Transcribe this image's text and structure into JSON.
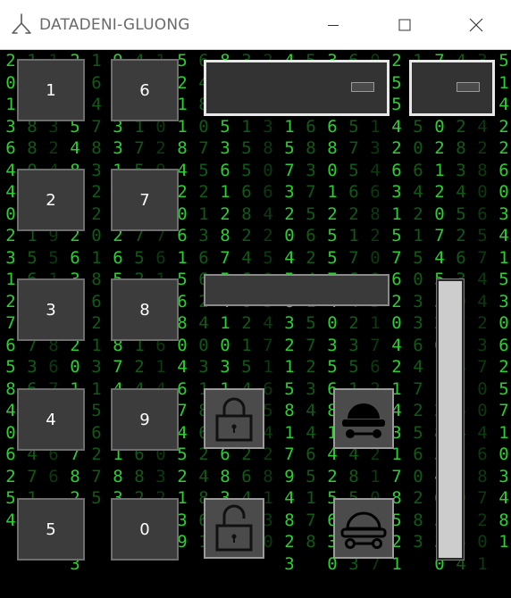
{
  "window": {
    "title": "DATADENI-GLUONG",
    "controls": [
      "minimize",
      "maximize",
      "close"
    ]
  },
  "keypad": {
    "left_column": [
      "1",
      "2",
      "3",
      "4",
      "5"
    ],
    "right_column": [
      "6",
      "7",
      "8",
      "9",
      "0"
    ]
  },
  "dropdowns": [
    {
      "name": "dropdown-wide",
      "value": ""
    },
    {
      "name": "dropdown-small",
      "value": ""
    }
  ],
  "text_field": {
    "value": ""
  },
  "actions": {
    "lock": "lock-closed-icon",
    "unlock": "lock-open-icon",
    "hat_filled": "hat-filled-icon",
    "hat_outline": "hat-outline-icon"
  },
  "slider": {
    "level": 1.0
  },
  "background": {
    "style": "matrix-digit-rain",
    "colors": {
      "bright": "#29d12e",
      "dim": "#0f5a14",
      "faint": "#0a3a0d"
    },
    "columns": [
      "20 13 6  4     4 0 2 3  12 7 6 5 8  4 0 6  2 54",
      " 1 2 28 8 0 9 3  1 5 6 2 8 7 3 6 4 0 4 7 1 2 9",
      "  1 8 7 3   2 4 5 6   9 5 1 3 7 8 6 7   3 1 6 6",
      "2 03 5 4 8 8 2 2 6   3 8 4 2 0 1 9 6 7 8 2 5 0 3",
      "  1 6 4  7 8 3 2  2 0 1  8  6 2 1 3 1 5 6 2 7 5",
      " 9  0 4 3  3 1 5 6 2  6 5 0 3 8 7 4 2 0 1 8 3 0",
      "4 3 2 1  7 5 8 6  7 5 2 0 3 1 2 4 3 5 6 8 2 7 1",
      "  1 4  8 0 2 9 5  4 7 6 1  3 8 6 1 4 5 9 0  3 2",
      "5 2 1 1 8  4 2 0 6 1  5 6 8 0 4 6 7 4 5 2 1 3 9",
      " 6 4 8 0 7  5 2 1 3 6 6 2 4 0 3 1 8 6 2 4 8 6 1",
      "8 2  7 5 3 6 1  2  8 7 5 4 1 0 3 1 4 5 6 8 3 2 0",
      " 3 2 0 1 5 5 6 8 2 4 6 0 2  1 5 4 3 7 2 6 4 6 5",
      "2 5  1 3 8 0 6  4 2 5 0 3 4 7 1 6 5  4 2 8 1 3 0",
      " 4 6 8 1 5 7 3 2 0 4 5 6 3 2 1 5 8 1 7 9 4 8 2 3",
      "5 2 4 6 8 3 7  5 6 2 4 1 5 7 2 3 4  4 6 5 1 7 8",
      " 3 2 4 6 8 0 1 2 5 5 7 4 0 3 5 6 8 1 4 2 5 6 3 0",
      "6 2 4 5 7 5 6 2 1 7 6 4 2 3 5 1 3 0 4 8 5 0 4 3",
      " 0 5 1 1 3 4 6 8 2 0 0 3 1 7 6 2 5 4 2 1 0 6 4 7",
      "2 5 5 4 2 6 3 1 5 7 6 2 0 4 2 1 4 3 1 7 8 5 2 1",
      " 1 2 3 5 0 6 4 2 1 5 0 3 3 6 4 7 2 5 6 0 2 8 3",
      "7 3 3 0 2 1 2 0 7 4 5 3 2 6 1 1 2 8 3 4 6 5 3 0",
      " 4 7 5 2 8 3 4 5 2 6 3 0 7 2 8 3 6 4 7 5 0 2 6 4",
      "3 1 3 4 2 8 0 6 5 7 4 4 2 3 7 0 0 4 6 8 7 2 0 1",
      " 5 1 4 2 2 6 0 3 4 1 5 3 0 6 2 5 7 1 0 3 4 8 1"
    ]
  }
}
